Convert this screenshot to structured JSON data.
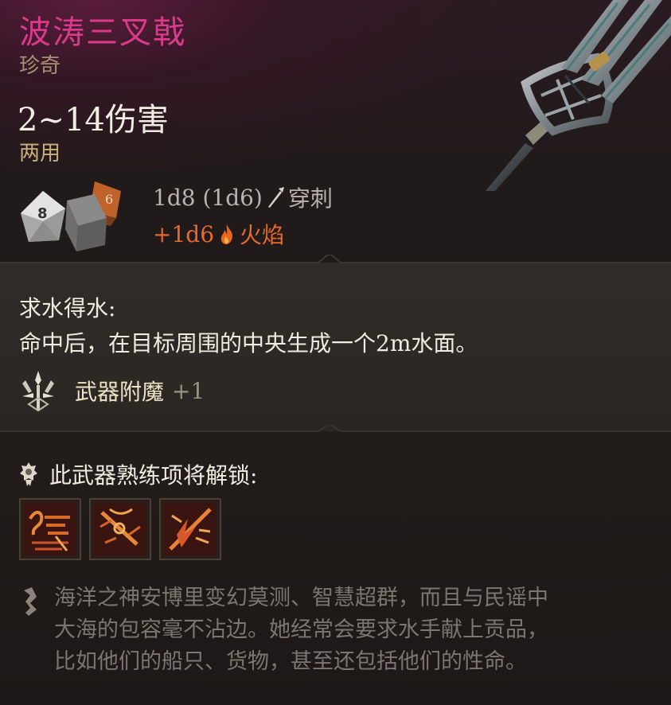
{
  "item": {
    "name": "波涛三叉戟",
    "rarity": "珍奇",
    "damage": "2~14伤害",
    "hands": "两用"
  },
  "dice": {
    "primary": "1d8 (1d6)",
    "primary_type": "穿刺",
    "bonus": "+1d6",
    "bonus_type": "火焰",
    "d8_face": "8",
    "d6_face": "6"
  },
  "passive": {
    "title": "求水得水:",
    "description": "命中后，在目标周围的中央生成一个2m水面。"
  },
  "enchantment": {
    "label": "武器附魔",
    "value": "+1"
  },
  "proficiency": {
    "title": "此武器熟练项将解锁:",
    "actions": [
      {
        "icon": "action-weapon-lunge-icon"
      },
      {
        "icon": "action-weapon-strike-icon"
      },
      {
        "icon": "action-weapon-flurry-icon"
      }
    ]
  },
  "flavor": {
    "lines": [
      "海洋之神安博里变幻莫测、智慧超群，而且与民谣中",
      "大海的包容毫不沾边。她经常会要求水手献上贡品，",
      "比如他们的船只、货物，甚至还包括他们的性命。"
    ]
  },
  "colors": {
    "name": "#d93a8a",
    "rarity": "#a89074",
    "fire": "#e66a2c",
    "flavor": "#7c7670"
  }
}
